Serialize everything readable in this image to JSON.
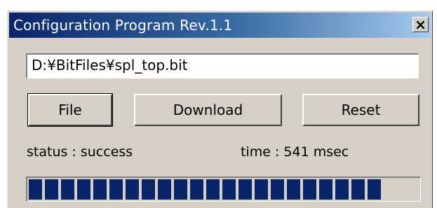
{
  "window": {
    "title": "Configuration Program  Rev.1.1",
    "close_glyph": "×"
  },
  "file_path": {
    "value": "D:¥BitFiles¥spl_top.bit"
  },
  "buttons": {
    "file_label": "File",
    "download_label": "Download",
    "reset_label": "Reset"
  },
  "status": {
    "status_text": "status : success",
    "time_text": "time : 541  msec"
  },
  "progress": {
    "fraction": 1.0,
    "block_count": 22,
    "fill_color": "#0a246a"
  },
  "colors": {
    "title_gradient_start": "#0a246a",
    "title_gradient_end": "#a6caf0",
    "face": "#d4d0c8"
  }
}
